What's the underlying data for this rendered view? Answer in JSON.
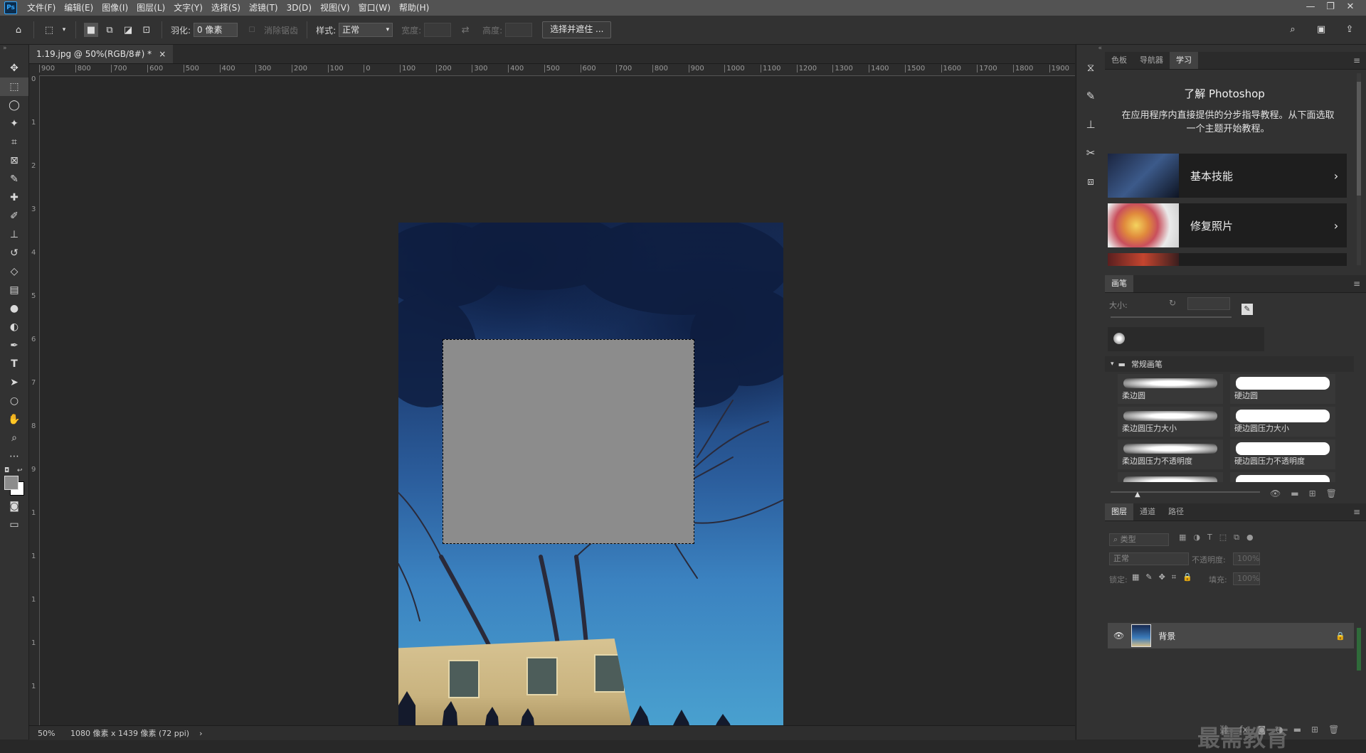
{
  "menubar": {
    "logo": "Ps",
    "items": [
      "文件(F)",
      "编辑(E)",
      "图像(I)",
      "图层(L)",
      "文字(Y)",
      "选择(S)",
      "滤镜(T)",
      "3D(D)",
      "视图(V)",
      "窗口(W)",
      "帮助(H)"
    ],
    "window_buttons": [
      "—",
      "❐",
      "✕"
    ]
  },
  "options": {
    "feather_label": "羽化:",
    "feather_value": "0 像素",
    "antialias_label": "消除锯齿",
    "style_label": "样式:",
    "style_value": "正常",
    "width_label": "宽度:",
    "height_label": "高度:",
    "select_mask_button": "选择并遮住 ..."
  },
  "document": {
    "tab_title": "1.19.jpg @ 50%(RGB/8#) *",
    "tab_close": "×",
    "zoom": "50%",
    "dimensions": "1080 像素 x 1439 像素 (72 ppi)",
    "status_arrow": "›"
  },
  "ruler": {
    "h_labels": [
      "900",
      "800",
      "700",
      "600",
      "500",
      "400",
      "300",
      "200",
      "100",
      "0",
      "100",
      "200",
      "300",
      "400",
      "500",
      "600",
      "700",
      "800",
      "900",
      "1000",
      "1100",
      "1200",
      "1300",
      "1400",
      "1500",
      "1600",
      "1700",
      "1800",
      "1900"
    ],
    "v_labels": [
      "0",
      "1",
      "2",
      "3",
      "4",
      "5",
      "6",
      "7",
      "8",
      "9",
      "1",
      "1",
      "1",
      "1",
      "1"
    ]
  },
  "panels": {
    "top_tabs": [
      "色板",
      "导航器",
      "学习"
    ],
    "learn": {
      "title": "了解 Photoshop",
      "description": "在应用程序内直接提供的分步指导教程。从下面选取一个主题开始教程。",
      "cards": [
        {
          "label": "基本技能"
        },
        {
          "label": "修复照片"
        }
      ]
    },
    "brush": {
      "tab": "画笔",
      "size_label": "大小:",
      "group_name": "常规画笔",
      "brushes": [
        "柔边圆",
        "硬边圆",
        "柔边圆压力大小",
        "硬边圆压力大小",
        "柔边圆压力不透明度",
        "硬边圆压力不透明度"
      ]
    },
    "layers": {
      "tabs": [
        "图层",
        "通道",
        "路径"
      ],
      "filter_placeholder": "类型",
      "blend_mode": "正常",
      "opacity_label": "不透明度:",
      "opacity_value": "100%",
      "lock_label": "锁定:",
      "fill_label": "填充:",
      "fill_value": "100%",
      "layer_name": "背景"
    }
  },
  "watermark": "最需教育",
  "colors": {
    "accent": "#31a8ff",
    "selection_fill": "#8c8c8c"
  }
}
